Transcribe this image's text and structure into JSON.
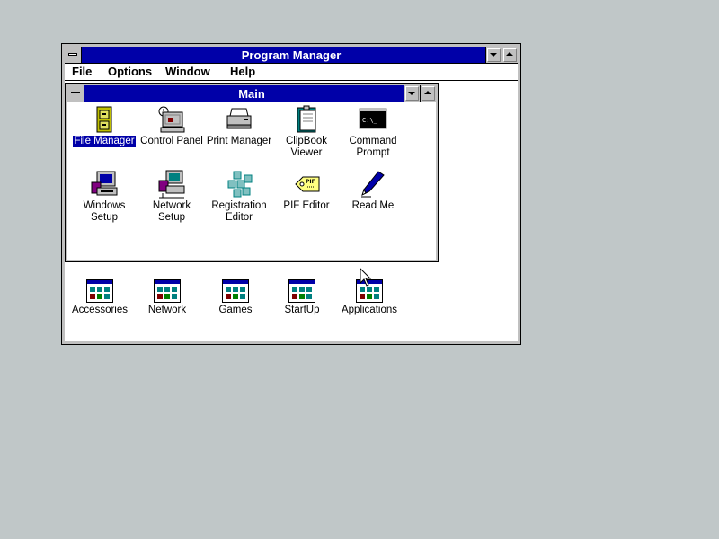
{
  "program_manager": {
    "title": "Program Manager",
    "menu": [
      "File",
      "Options",
      "Window",
      "Help"
    ]
  },
  "main_group": {
    "title": "Main",
    "icons": [
      {
        "label": "File Manager",
        "icon": "file-cabinet-icon",
        "selected": true
      },
      {
        "label": "Control Panel",
        "icon": "control-panel-icon"
      },
      {
        "label": "Print Manager",
        "icon": "printer-icon"
      },
      {
        "label": "ClipBook Viewer",
        "icon": "clipbook-icon"
      },
      {
        "label": "Command Prompt",
        "icon": "command-prompt-icon",
        "screen_text": "C:\\_"
      },
      {
        "label": "Windows Setup",
        "icon": "windows-setup-icon"
      },
      {
        "label": "Network Setup",
        "icon": "network-setup-icon"
      },
      {
        "label": "Registration Editor",
        "icon": "registry-cubes-icon"
      },
      {
        "label": "PIF Editor",
        "icon": "pif-tag-icon",
        "tag_text": "PIF"
      },
      {
        "label": "Read Me",
        "icon": "pen-icon"
      }
    ]
  },
  "groups": [
    {
      "label": "Accessories"
    },
    {
      "label": "Network"
    },
    {
      "label": "Games"
    },
    {
      "label": "StartUp"
    },
    {
      "label": "Applications"
    }
  ],
  "colors": {
    "desktop": "#c0c7c8",
    "titlebar": "#0000a8",
    "selection": "#0000a8",
    "window_frame": "#c0c0c0"
  }
}
